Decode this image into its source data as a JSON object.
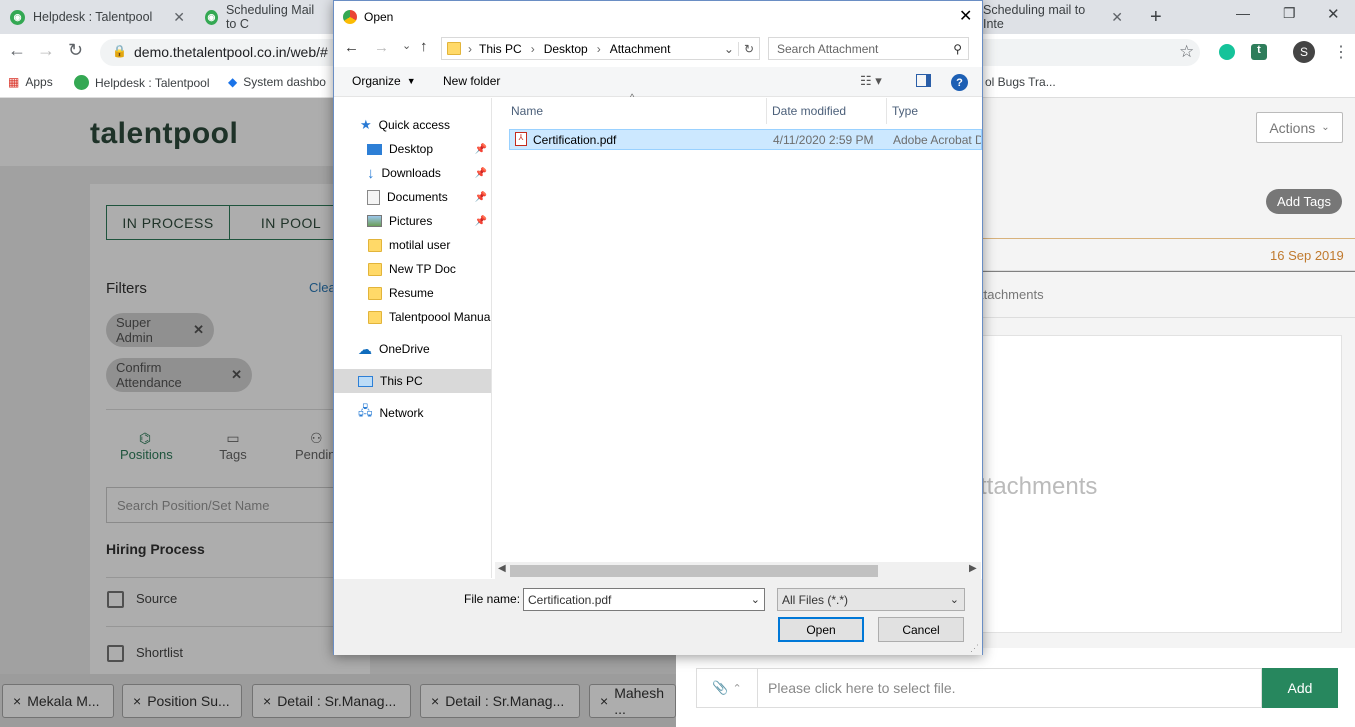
{
  "browser": {
    "tabs": [
      {
        "label": "Helpdesk : Talentpool"
      },
      {
        "label": "Scheduling Mail to C"
      },
      {
        "label": "Scheduling mail to Inte"
      }
    ],
    "url": "demo.thetalentpool.co.in/web/#",
    "bookmarks": [
      "Apps",
      "Helpdesk : Talentpool",
      "System dashbo",
      "ol Bugs Tra..."
    ],
    "avatar_letter": "S"
  },
  "app": {
    "logo": "talentpool",
    "segments": [
      "IN PROCESS",
      "IN POOL"
    ],
    "filters_title": "Filters",
    "clear_label": "Clea",
    "filter_chips": [
      "Super Admin",
      "Confirm Attendance"
    ],
    "icon_tabs": [
      "Positions",
      "Tags",
      "Pendin"
    ],
    "search_placeholder": "Search Position/Set Name",
    "hiring_title": "Hiring Process",
    "hiring_items": [
      "Source",
      "Shortlist"
    ],
    "bottom_tabs": [
      "Mekala M...",
      "Position Su...",
      "Detail : Sr.Manag...",
      "Detail : Sr.Manag...",
      "Mahesh ..."
    ],
    "actions_label": "Actions",
    "add_tags_label": "Add Tags",
    "date_label": "16 Sep 2019",
    "attachments_tab": "ttachments",
    "attachments_empty": "ttachments",
    "file_placeholder": "Please click here to select file.",
    "add_label": "Add"
  },
  "dialog": {
    "title": "Open",
    "breadcrumb": [
      "This PC",
      "Desktop",
      "Attachment"
    ],
    "search_placeholder": "Search Attachment",
    "organize_label": "Organize",
    "new_folder_label": "New folder",
    "tree": {
      "quick_access": "Quick access",
      "items": [
        {
          "label": "Desktop",
          "icon": "desktop-icon",
          "pinned": true
        },
        {
          "label": "Downloads",
          "icon": "download-icon",
          "pinned": true
        },
        {
          "label": "Documents",
          "icon": "documents-icon",
          "pinned": true
        },
        {
          "label": "Pictures",
          "icon": "pictures-icon",
          "pinned": true
        },
        {
          "label": "motilal user",
          "icon": "folder-icon",
          "pinned": false
        },
        {
          "label": "New TP Doc",
          "icon": "folder-icon",
          "pinned": false
        },
        {
          "label": "Resume",
          "icon": "folder-icon",
          "pinned": false
        },
        {
          "label": "Talentpoool Manua",
          "icon": "folder-icon",
          "pinned": false
        }
      ],
      "onedrive": "OneDrive",
      "thispc": "This PC",
      "network": "Network"
    },
    "columns": [
      "Name",
      "Date modified",
      "Type"
    ],
    "files": [
      {
        "name": "Certification.pdf",
        "date": "4/11/2020 2:59 PM",
        "type": "Adobe Acrobat D"
      }
    ],
    "file_name_label": "File name:",
    "file_name_value": "Certification.pdf",
    "filter_value": "All Files (*.*)",
    "open_label": "Open",
    "cancel_label": "Cancel"
  }
}
